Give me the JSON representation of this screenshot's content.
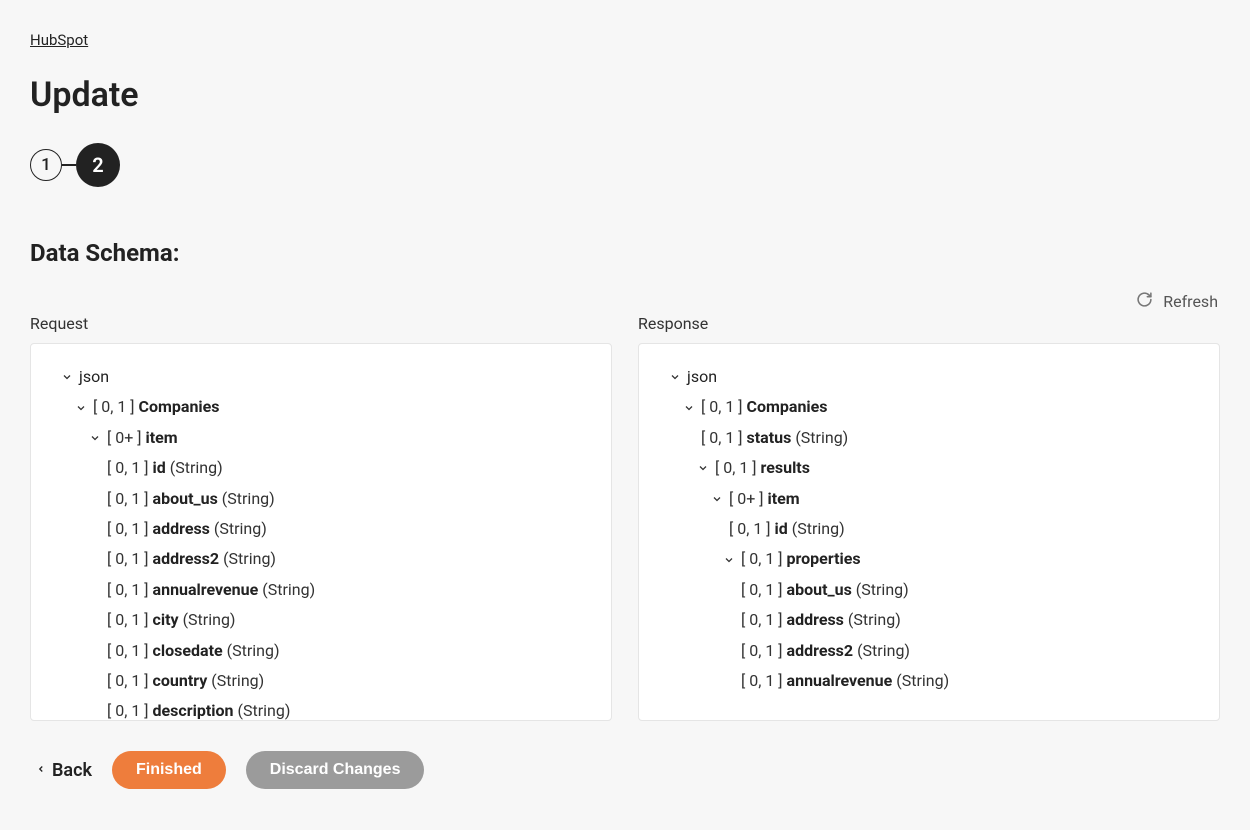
{
  "breadcrumb": "HubSpot",
  "title": "Update",
  "stepper": {
    "step1": "1",
    "step2": "2"
  },
  "section_heading": "Data Schema:",
  "refresh_label": "Refresh",
  "columns": {
    "request": "Request",
    "response": "Response"
  },
  "tree_labels": {
    "json": "json",
    "card_01": "[ 0, 1 ]",
    "card_0plus": "[ 0+ ]"
  },
  "request_tree": {
    "companies": "Companies",
    "item": "item",
    "fields": {
      "id": {
        "name": "id",
        "type": "(String)"
      },
      "about_us": {
        "name": "about_us",
        "type": "(String)"
      },
      "address": {
        "name": "address",
        "type": "(String)"
      },
      "address2": {
        "name": "address2",
        "type": "(String)"
      },
      "annualrevenue": {
        "name": "annualrevenue",
        "type": "(String)"
      },
      "city": {
        "name": "city",
        "type": "(String)"
      },
      "closedate": {
        "name": "closedate",
        "type": "(String)"
      },
      "country": {
        "name": "country",
        "type": "(String)"
      },
      "description": {
        "name": "description",
        "type": "(String)"
      }
    }
  },
  "response_tree": {
    "companies": "Companies",
    "status": {
      "name": "status",
      "type": "(String)"
    },
    "results": "results",
    "item": "item",
    "id": {
      "name": "id",
      "type": "(String)"
    },
    "properties": "properties",
    "fields": {
      "about_us": {
        "name": "about_us",
        "type": "(String)"
      },
      "address": {
        "name": "address",
        "type": "(String)"
      },
      "address2": {
        "name": "address2",
        "type": "(String)"
      },
      "annualrevenue": {
        "name": "annualrevenue",
        "type": "(String)"
      }
    }
  },
  "footer": {
    "back": "Back",
    "finished": "Finished",
    "discard": "Discard Changes"
  }
}
